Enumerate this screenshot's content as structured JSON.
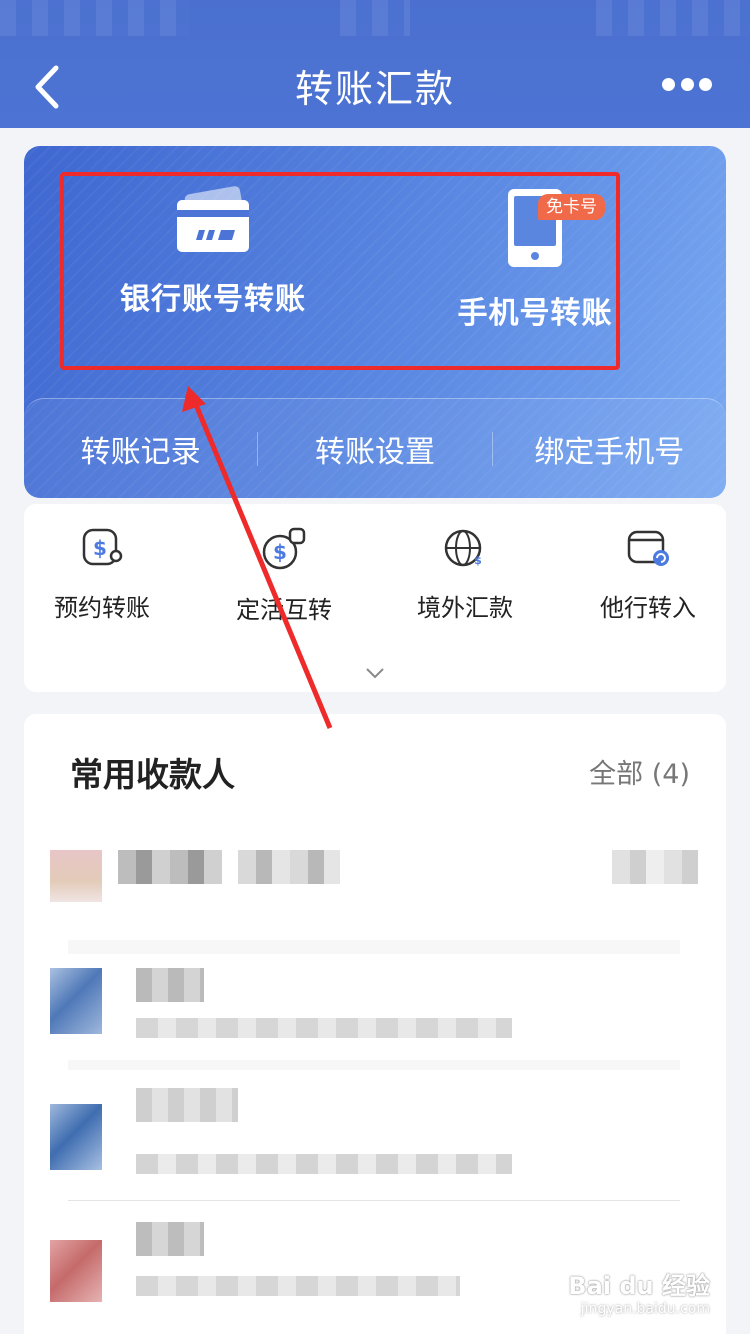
{
  "header": {
    "title": "转账汇款",
    "back_icon": "chevron-left-icon",
    "more_icon": "more-dots-icon"
  },
  "hero": {
    "actions": [
      {
        "label": "银行账号转账",
        "icon": "bank-card-icon"
      },
      {
        "label": "手机号转账",
        "icon": "mobile-phone-icon",
        "badge": "免卡号"
      }
    ],
    "sub_nav": [
      "转账记录",
      "转账设置",
      "绑定手机号"
    ],
    "highlight_color": "#ee2a2a"
  },
  "services": {
    "items": [
      {
        "label": "预约转账",
        "icon": "scheduled-transfer-icon"
      },
      {
        "label": "定活互转",
        "icon": "deposit-transfer-icon"
      },
      {
        "label": "境外汇款",
        "icon": "globe-remittance-icon"
      },
      {
        "label": "他行转入",
        "icon": "wallet-transfer-in-icon"
      }
    ],
    "expand_icon": "chevron-down-icon"
  },
  "payees": {
    "title": "常用收款人",
    "all_label": "全部 (4)"
  },
  "watermark": {
    "main": "Bai du 经验",
    "sub": "jingyan.baidu.com"
  },
  "colors": {
    "header": "#4a6fcf",
    "accent": "#4d7ae0",
    "annotation": "#ee2a2a"
  }
}
